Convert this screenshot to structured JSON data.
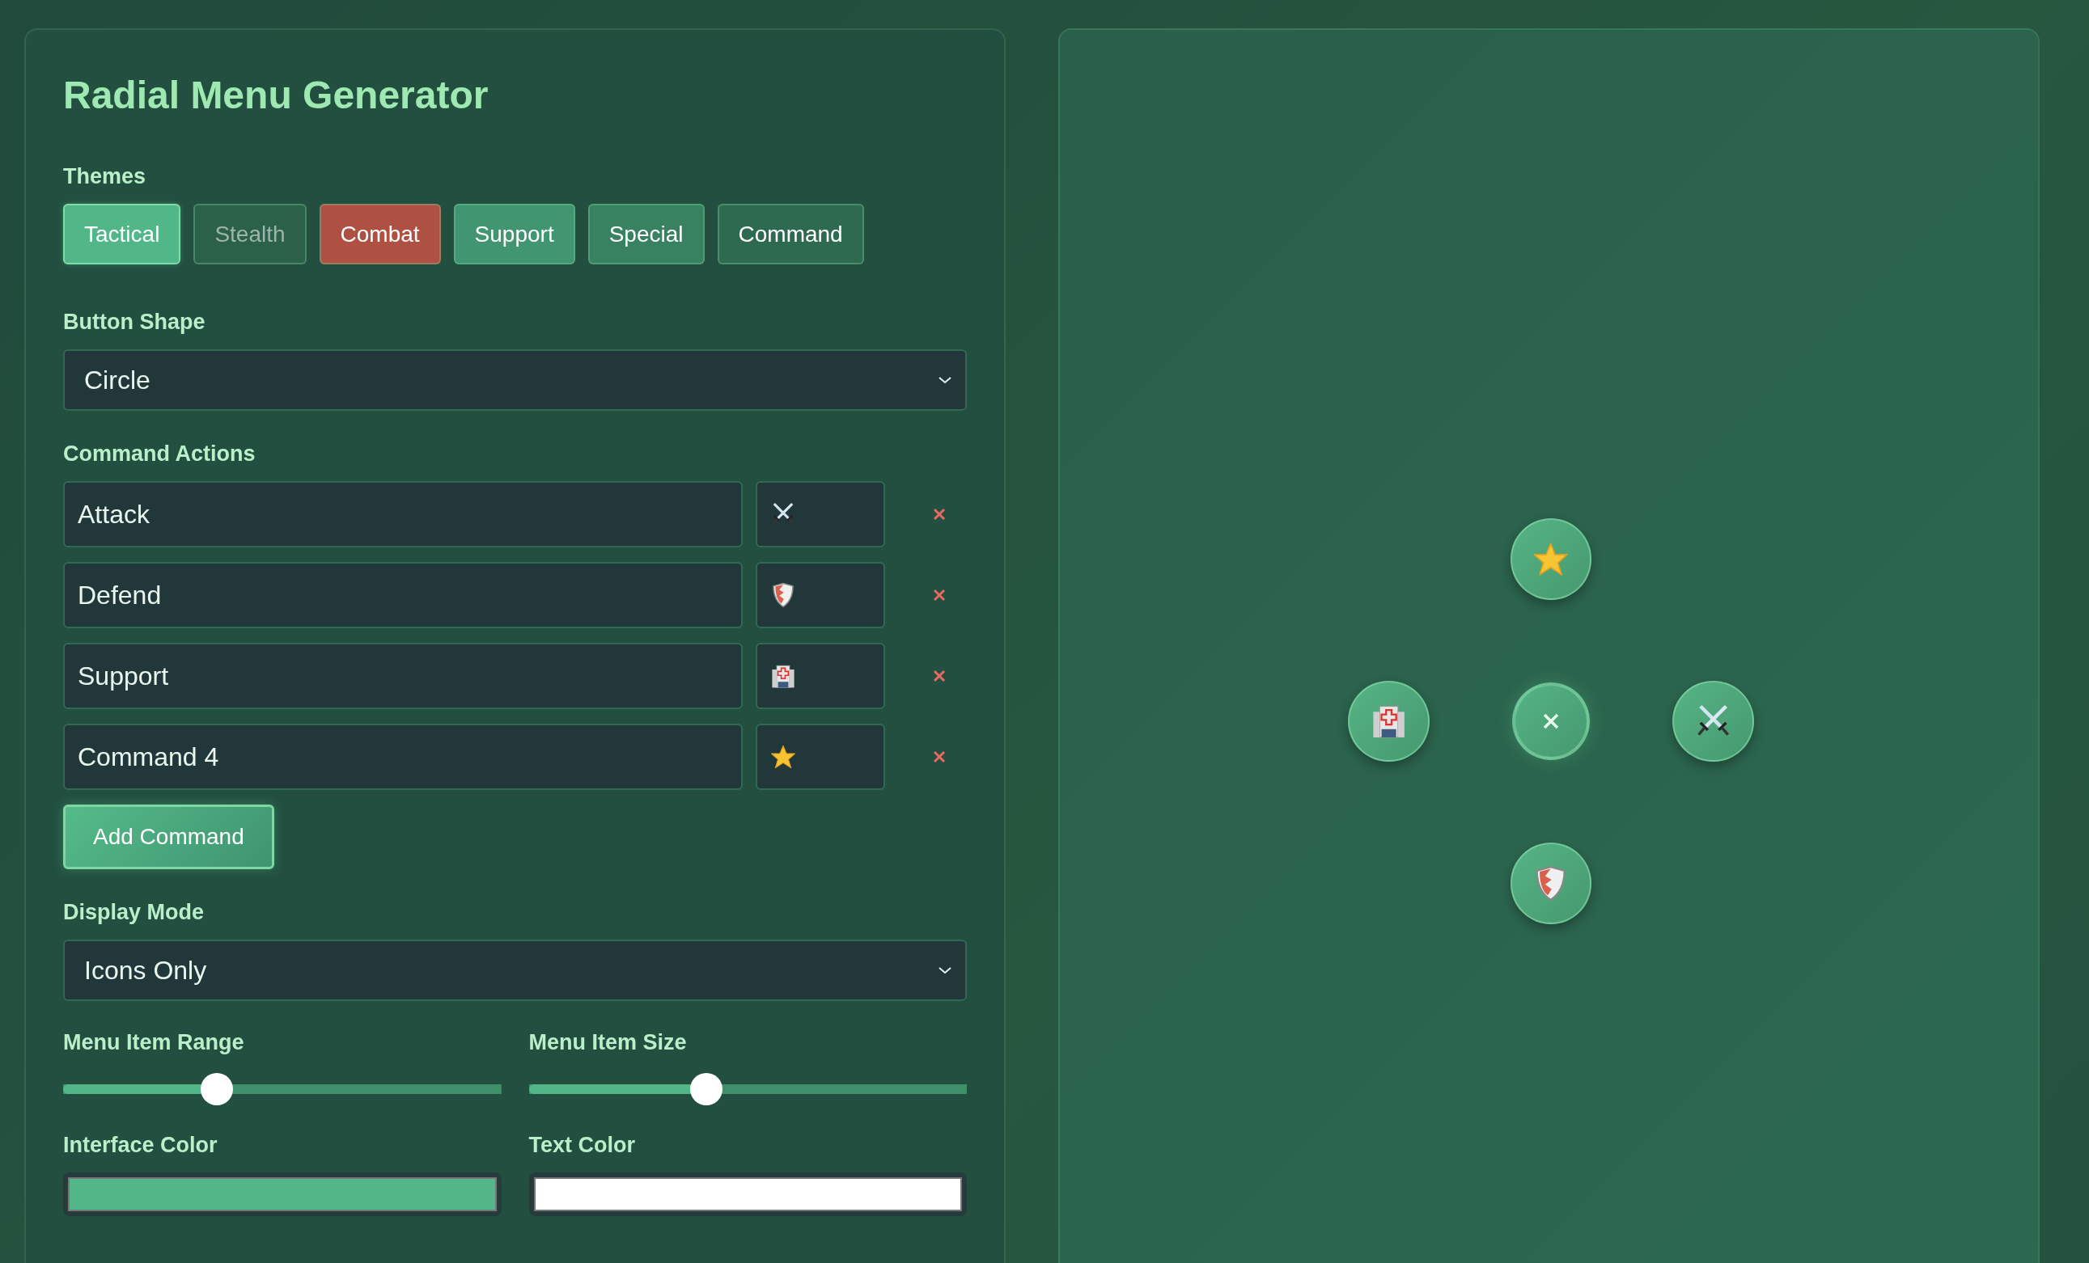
{
  "title": "Radial Menu Generator",
  "themes_label": "Themes",
  "themes": [
    {
      "label": "Tactical",
      "selected": true,
      "color": "#52b788"
    },
    {
      "label": "Stealth",
      "selected": false,
      "color": "#2b6049"
    },
    {
      "label": "Combat",
      "selected": false,
      "color": "#ae5142"
    },
    {
      "label": "Support",
      "selected": false,
      "color": "#419570"
    },
    {
      "label": "Special",
      "selected": false,
      "color": "#388262"
    },
    {
      "label": "Command",
      "selected": false,
      "color": "#2e6a50"
    }
  ],
  "button_shape": {
    "label": "Button Shape",
    "value": "Circle"
  },
  "commands_label": "Command Actions",
  "commands": [
    {
      "name": "Attack",
      "kind": "swords"
    },
    {
      "name": "Defend",
      "kind": "shield"
    },
    {
      "name": "Support",
      "kind": "hospital"
    },
    {
      "name": "Command 4",
      "kind": "star"
    }
  ],
  "add_button": "Add Command",
  "display_mode": {
    "label": "Display Mode",
    "value": "Icons Only"
  },
  "sliders": [
    {
      "label": "Menu Item Range",
      "level": 0.35
    },
    {
      "label": "Menu Item Size",
      "level": 0.405
    }
  ],
  "colors": [
    {
      "label": "Interface Color",
      "color": "#52b788"
    },
    {
      "label": "Text Color",
      "color": "#ffffff"
    }
  ]
}
